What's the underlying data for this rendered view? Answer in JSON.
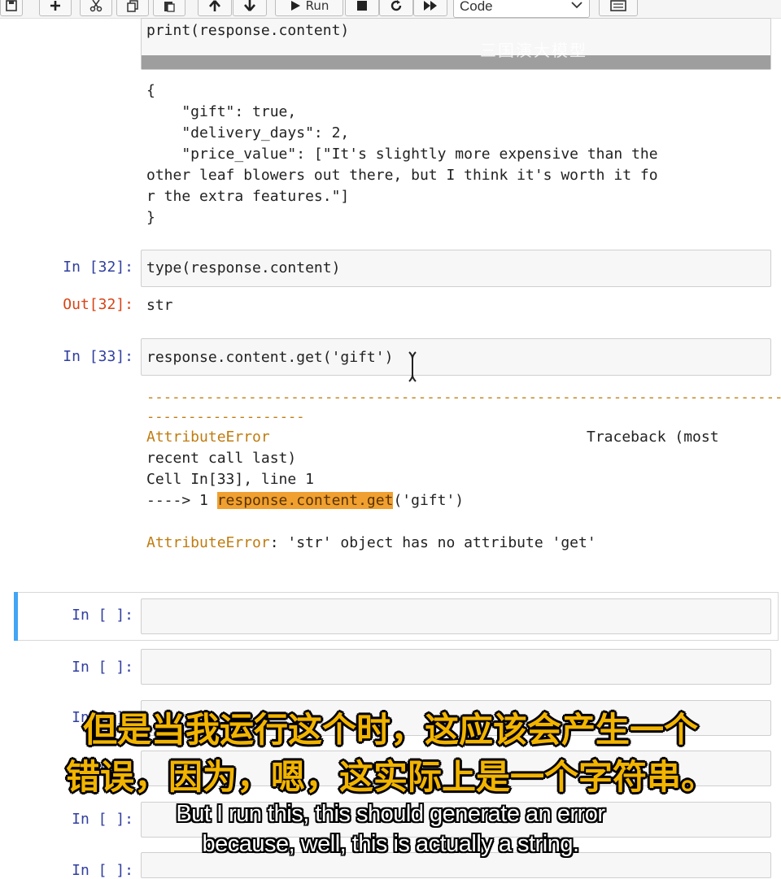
{
  "toolbar": {
    "run_label": "Run",
    "cell_type": "Code"
  },
  "cells": {
    "print_cell": {
      "code": "print(response.content)"
    },
    "print_output": [
      "{",
      "    \"gift\": true,",
      "    \"delivery_days\": 2,",
      "    \"price_value\": [\"It's slightly more expensive than the",
      "other leaf blowers out there, but I think it's worth it fo",
      "r the extra features.\"]",
      "}"
    ],
    "cell32": {
      "prompt_in": "In [32]:",
      "code": "type(response.content)",
      "prompt_out": "Out[32]:",
      "output": "str"
    },
    "cell33": {
      "prompt_in": "In [33]:",
      "code": "response.content.get('gift')",
      "error": {
        "dashes_line1": "---------------------------------------------------------------------------",
        "dashes_line2": "-------------------",
        "error_name": "AttributeError",
        "traceback_label": "Traceback (most",
        "line2": "recent call last)",
        "cell_word": "Cell ",
        "cell_ref": "In[33], line 1",
        "arrow": "----> 1 ",
        "highlighted": "response.content.get",
        "rest": "('gift')",
        "final_name": "AttributeError",
        "final_msg": ": 'str' object has no attribute 'get'"
      }
    },
    "empty_prompt": "In [ ]:"
  },
  "watermark": "三国演大模型",
  "subtitles": {
    "cn_line1": "但是当我运行这个时，这应该会产生一个",
    "cn_line2": "错误，因为，嗯，这实际上是一个字符串。",
    "en_line1": "But I run this, this should generate an error",
    "en_line2": "because, well, this is actually a string."
  }
}
